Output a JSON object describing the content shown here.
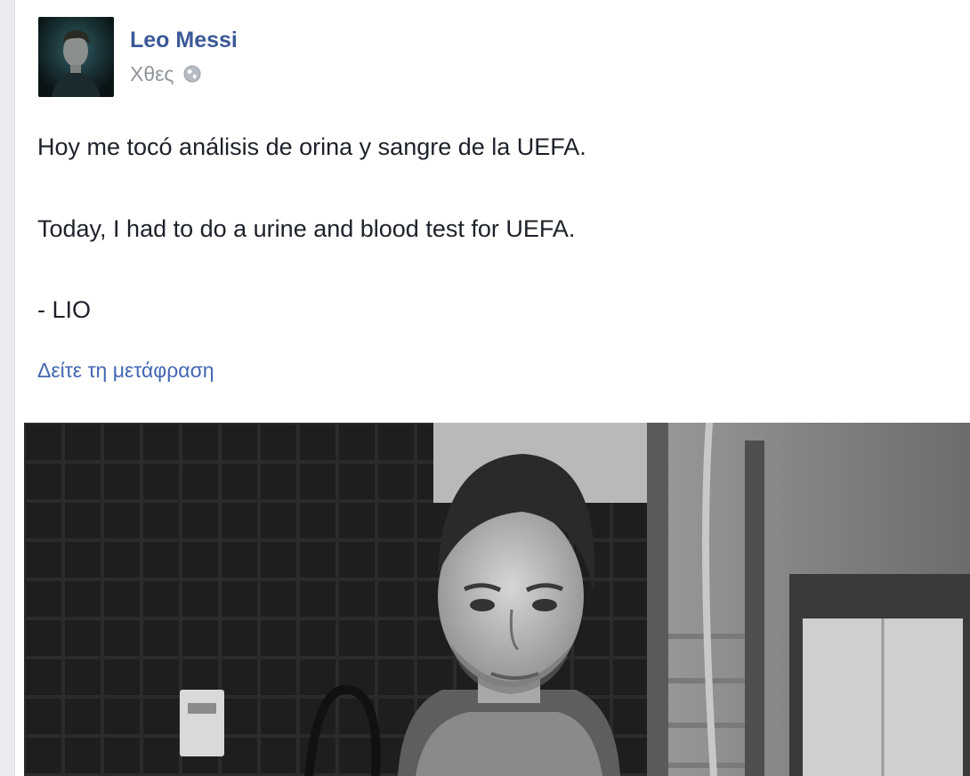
{
  "post": {
    "author": "Leo Messi",
    "timestamp": "Χθες",
    "privacy_icon": "globe-icon",
    "lines": [
      "Hoy me tocó análisis de orina y sangre de la UEFA.",
      "Today, I had to do a urine and blood test for UEFA.",
      "- LIO"
    ],
    "see_translation": "Δείτε τη μετάφραση"
  },
  "colors": {
    "author_link": "#3b5998",
    "translation_link": "#4267b2",
    "meta_gray": "#90949c",
    "body_text": "#1d2129",
    "page_background": "#e9ebee"
  }
}
